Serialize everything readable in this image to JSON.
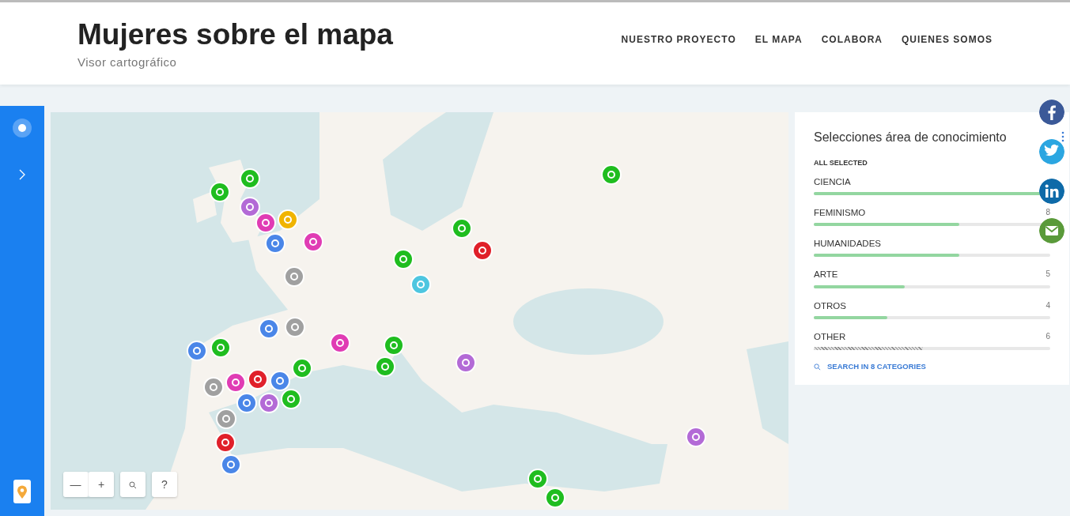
{
  "header": {
    "title": "Mujeres sobre el mapa",
    "subtitle": "Visor cartográfico",
    "nav": [
      {
        "label": "NUESTRO PROYECTO"
      },
      {
        "label": "EL MAPA"
      },
      {
        "label": "COLABORA"
      },
      {
        "label": "QUIENES SOMOS"
      }
    ]
  },
  "map": {
    "markers": [
      {
        "color": "#1fbd1f"
      },
      {
        "color": "#1fbd1f"
      },
      {
        "color": "#b36ad6"
      },
      {
        "color": "#e03cb4"
      },
      {
        "color": "#f0b400"
      },
      {
        "color": "#4a86e8"
      },
      {
        "color": "#e03cb4"
      },
      {
        "color": "#a0a0a0"
      },
      {
        "color": "#1fbd1f"
      },
      {
        "color": "#4ec6e0"
      },
      {
        "color": "#1fbd1f"
      },
      {
        "color": "#e0202a"
      },
      {
        "color": "#1fbd1f"
      },
      {
        "color": "#4a86e8"
      },
      {
        "color": "#a0a0a0"
      },
      {
        "color": "#e03cb4"
      },
      {
        "color": "#4a86e8"
      },
      {
        "color": "#1fbd1f"
      },
      {
        "color": "#1fbd1f"
      },
      {
        "color": "#1fbd1f"
      },
      {
        "color": "#b36ad6"
      },
      {
        "color": "#1fbd1f"
      },
      {
        "color": "#a0a0a0"
      },
      {
        "color": "#e03cb4"
      },
      {
        "color": "#e0202a"
      },
      {
        "color": "#4a86e8"
      },
      {
        "color": "#4a86e8"
      },
      {
        "color": "#b36ad6"
      },
      {
        "color": "#1fbd1f"
      },
      {
        "color": "#a0a0a0"
      },
      {
        "color": "#e0202a"
      },
      {
        "color": "#4a86e8"
      },
      {
        "color": "#b36ad6"
      },
      {
        "color": "#1fbd1f"
      },
      {
        "color": "#1fbd1f"
      }
    ],
    "controls": {
      "zoom_out": "—",
      "zoom_in": "+",
      "help": "?"
    }
  },
  "widget": {
    "title": "Selecciones área de conocimiento",
    "status": "ALL SELECTED",
    "categories": [
      {
        "name": "CIENCIA",
        "level": 1.0,
        "kind": "solid"
      },
      {
        "name": "FEMINISMO",
        "count": "8",
        "level": 0.615,
        "kind": "solid"
      },
      {
        "name": "HUMANIDADES",
        "level": 0.615,
        "kind": "solid"
      },
      {
        "name": "ARTE",
        "count": "5",
        "level": 0.385,
        "kind": "solid"
      },
      {
        "name": "OTROS",
        "count": "4",
        "level": 0.31,
        "kind": "solid"
      },
      {
        "name": "OTHER",
        "count": "6",
        "level": 0.46,
        "kind": "hatched"
      }
    ],
    "search": "SEARCH IN 8 CATEGORIES"
  },
  "share": [
    {
      "kind": "facebook"
    },
    {
      "kind": "twitter"
    },
    {
      "kind": "linkedin"
    },
    {
      "kind": "email"
    }
  ]
}
